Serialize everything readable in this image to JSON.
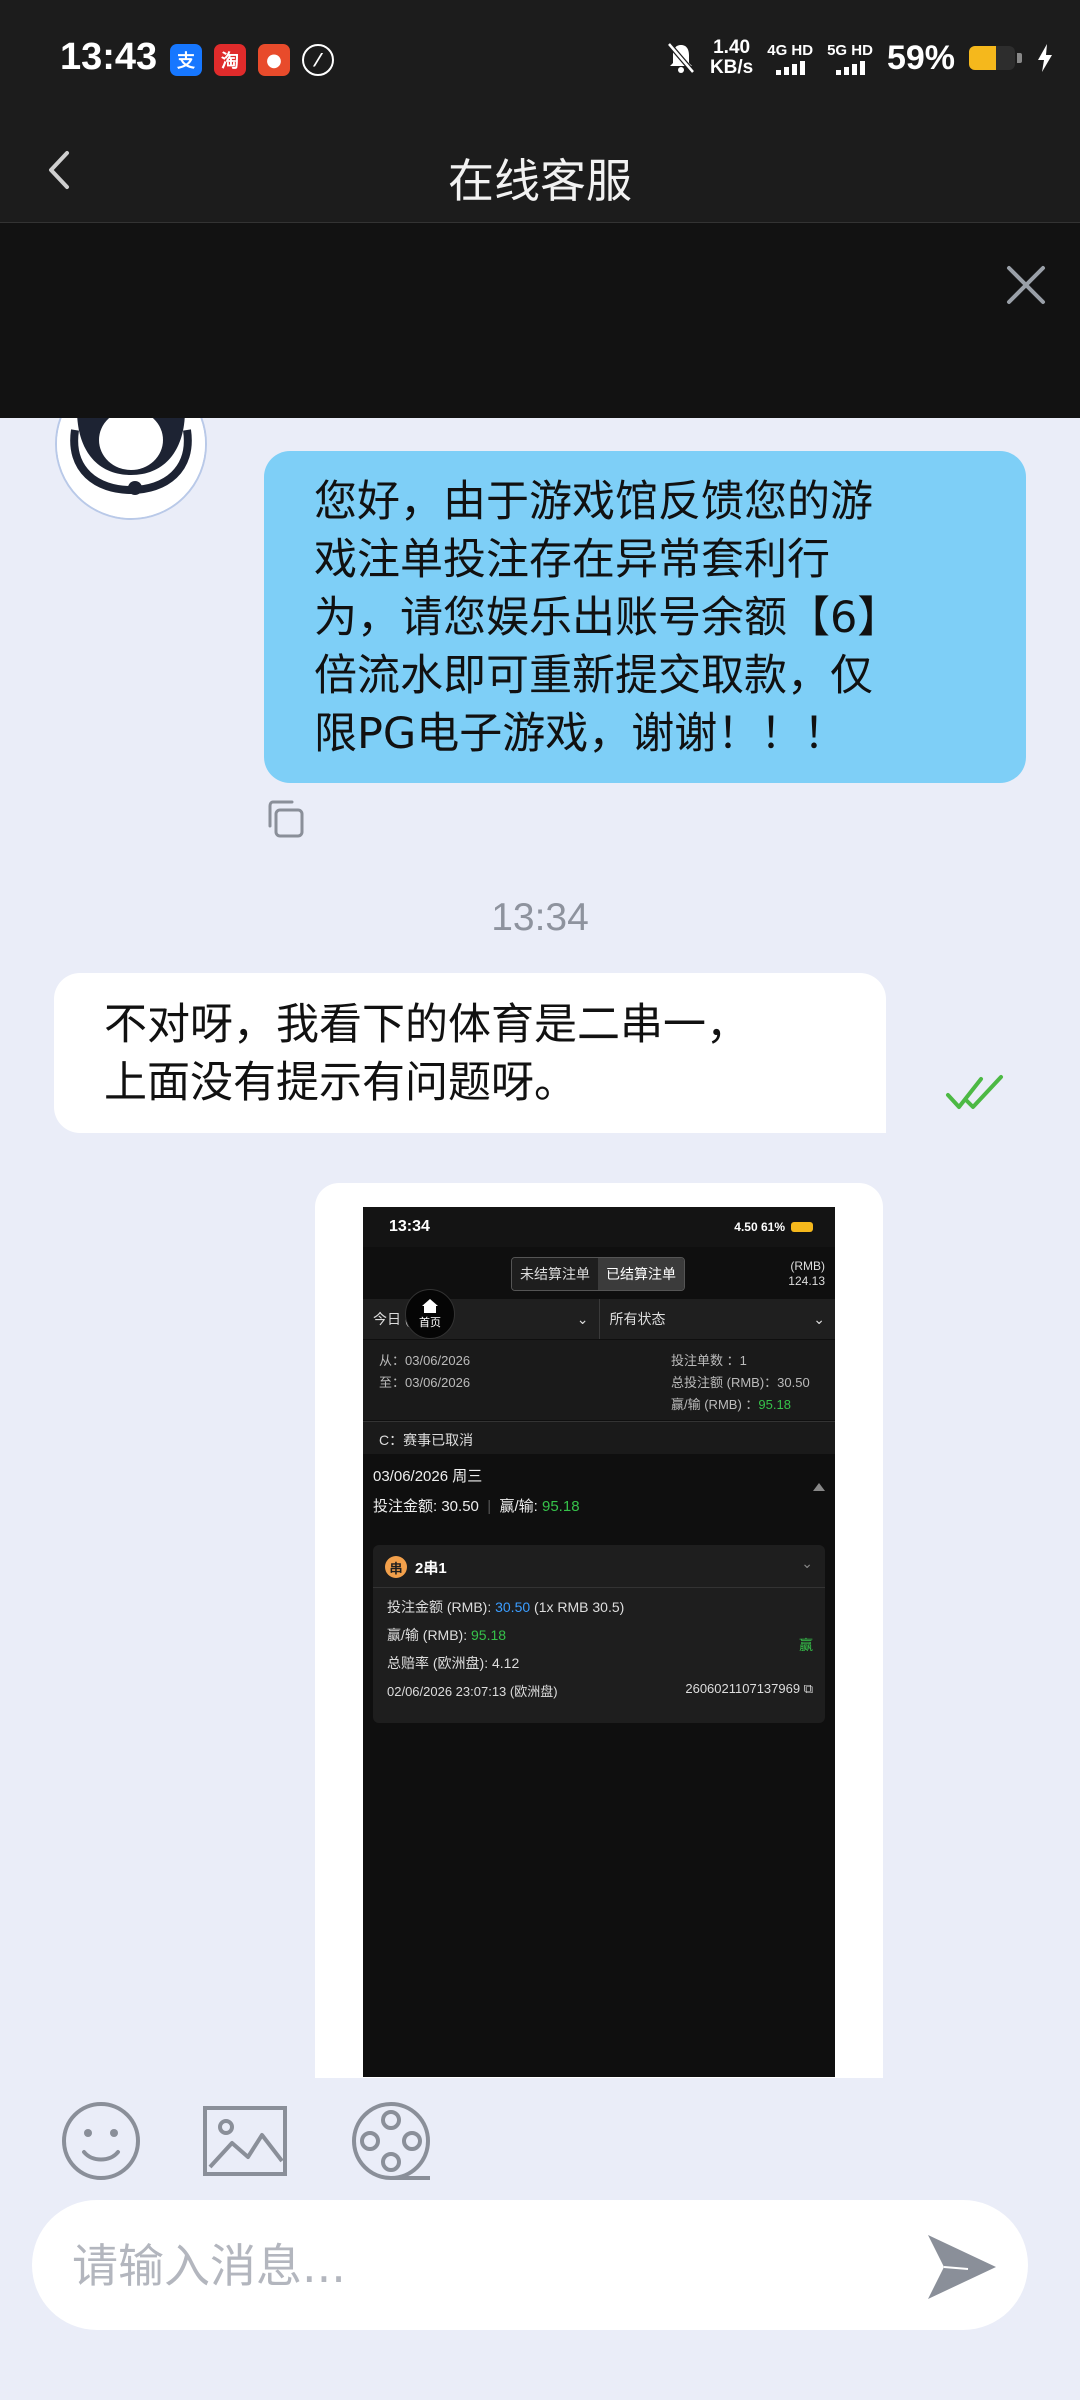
{
  "status_bar": {
    "time": "13:43",
    "net_speed": "1.40",
    "net_unit": "KB/s",
    "net1": "4G HD",
    "net2": "5G HD",
    "battery": "59%",
    "battery_level": 0.59
  },
  "header": {
    "title": "在线客服"
  },
  "chat": {
    "agent_message": [
      "您好，由于游戏馆反馈您的游",
      "戏注单投注存在异常套利行",
      "为，请您娱乐出账号余额【6】",
      "倍流水即可重新提交取款，仅",
      "限PG电子游戏，谢谢！！！"
    ],
    "timestamp": "13:34",
    "user_message": [
      "不对呀，我看下的体育是二串一，",
      "上面没有提示有问题呀。"
    ]
  },
  "screenshot": {
    "status_time": "13:34",
    "status_right": "4.50 61%",
    "tab_unsettled": "未结算注单",
    "tab_settled": "已结算注单",
    "rmb_label": "(RMB)",
    "rmb_value": "124.13",
    "home_label": "首页",
    "filter_date": "今日 (06)",
    "filter_status": "所有状态",
    "from": "从：03/06/2026",
    "to": "至：03/06/2026",
    "bet_count": "投注单数        ：1",
    "total_stake": "总投注额 (RMB)：30.50",
    "winloss_label": "赢/输 (RMB)      ：",
    "winloss_value": "95.18",
    "notice": "C：赛事已取消",
    "date_line": "03/06/2026 周三",
    "stake_label": "投注金额:",
    "stake_value": "30.50",
    "divider": "|",
    "win_label": "赢/输:",
    "win_value": "95.18",
    "badge": "串",
    "card_title": "2串1",
    "card_stake_label": "投注金额 (RMB):",
    "card_stake_value": "30.50",
    "card_stake_detail": "(1x RMB 30.5)",
    "card_win_label": "赢/输 (RMB):",
    "card_win_value": "95.18",
    "card_win_tag": "赢",
    "odds": "总赔率 (欧洲盘): 4.12",
    "bet_time": "02/06/2026 23:07:13 (欧洲盘)",
    "ticket": "2606021107137969"
  },
  "composer": {
    "placeholder": "请输入消息..."
  },
  "colors": {
    "agent_bubble": "#7ecff7",
    "background": "#eaedf8",
    "win_green": "#36c24a",
    "read_check": "#4cb944"
  },
  "icons": [
    "back-arrow-icon",
    "close-icon",
    "copy-icon",
    "double-check-icon",
    "emoji-icon",
    "image-icon",
    "video-reel-icon",
    "send-icon"
  ]
}
